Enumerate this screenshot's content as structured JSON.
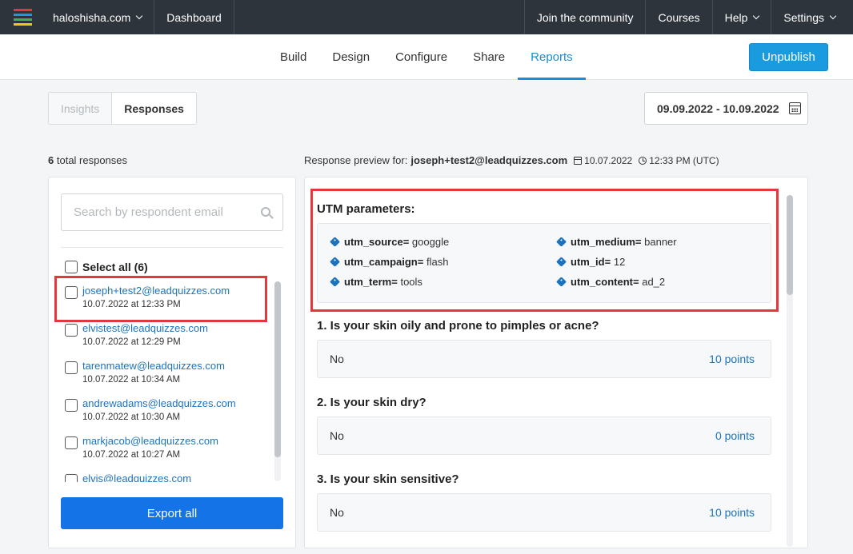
{
  "topbar": {
    "site": "haloshisha.com",
    "dashboard": "Dashboard",
    "community": "Join the community",
    "courses": "Courses",
    "help": "Help",
    "settings": "Settings",
    "logo_colors": [
      "#e1383d",
      "#1a9bdf",
      "#3bb54a",
      "#f5c518"
    ]
  },
  "subnav": {
    "tabs": [
      "Build",
      "Design",
      "Configure",
      "Share",
      "Reports"
    ],
    "active_tab": "Reports",
    "unpublish": "Unpublish"
  },
  "toggle": {
    "insights": "Insights",
    "responses": "Responses"
  },
  "date_range": "09.09.2022 - 10.09.2022",
  "summary": {
    "count": "6",
    "label": "total responses"
  },
  "preview": {
    "label": "Response preview for:",
    "email": "joseph+test2@leadquizzes.com",
    "date": "10.07.2022",
    "time": "12:33 PM (UTC)"
  },
  "search": {
    "placeholder": "Search by respondent email"
  },
  "select_all": "Select all (6)",
  "responses": [
    {
      "email": "joseph+test2@leadquizzes.com",
      "date": "10.07.2022 at 12:33 PM"
    },
    {
      "email": "elvistest@leadquizzes.com",
      "date": "10.07.2022 at 12:29 PM"
    },
    {
      "email": "tarenmatew@leadquizzes.com",
      "date": "10.07.2022 at 10:34 AM"
    },
    {
      "email": "andrewadams@leadquizzes.com",
      "date": "10.07.2022 at 10:30 AM"
    },
    {
      "email": "markjacob@leadquizzes.com",
      "date": "10.07.2022 at 10:27 AM"
    },
    {
      "email": "elvis@leadquizzes.com",
      "date": ""
    }
  ],
  "export_label": "Export all",
  "utm": {
    "title": "UTM parameters:",
    "params": [
      {
        "key": "utm_source=",
        "value": "googgle"
      },
      {
        "key": "utm_medium=",
        "value": "banner"
      },
      {
        "key": "utm_campaign=",
        "value": "flash"
      },
      {
        "key": "utm_id=",
        "value": "12"
      },
      {
        "key": "utm_term=",
        "value": "tools"
      },
      {
        "key": "utm_content=",
        "value": "ad_2"
      }
    ]
  },
  "questions": [
    {
      "text": "1. Is your skin oily and prone to pimples or acne?",
      "answer": "No",
      "points": "10 points"
    },
    {
      "text": "2. Is your skin dry?",
      "answer": "No",
      "points": "0 points"
    },
    {
      "text": "3. Is your skin sensitive?",
      "answer": "No",
      "points": "10 points"
    }
  ]
}
